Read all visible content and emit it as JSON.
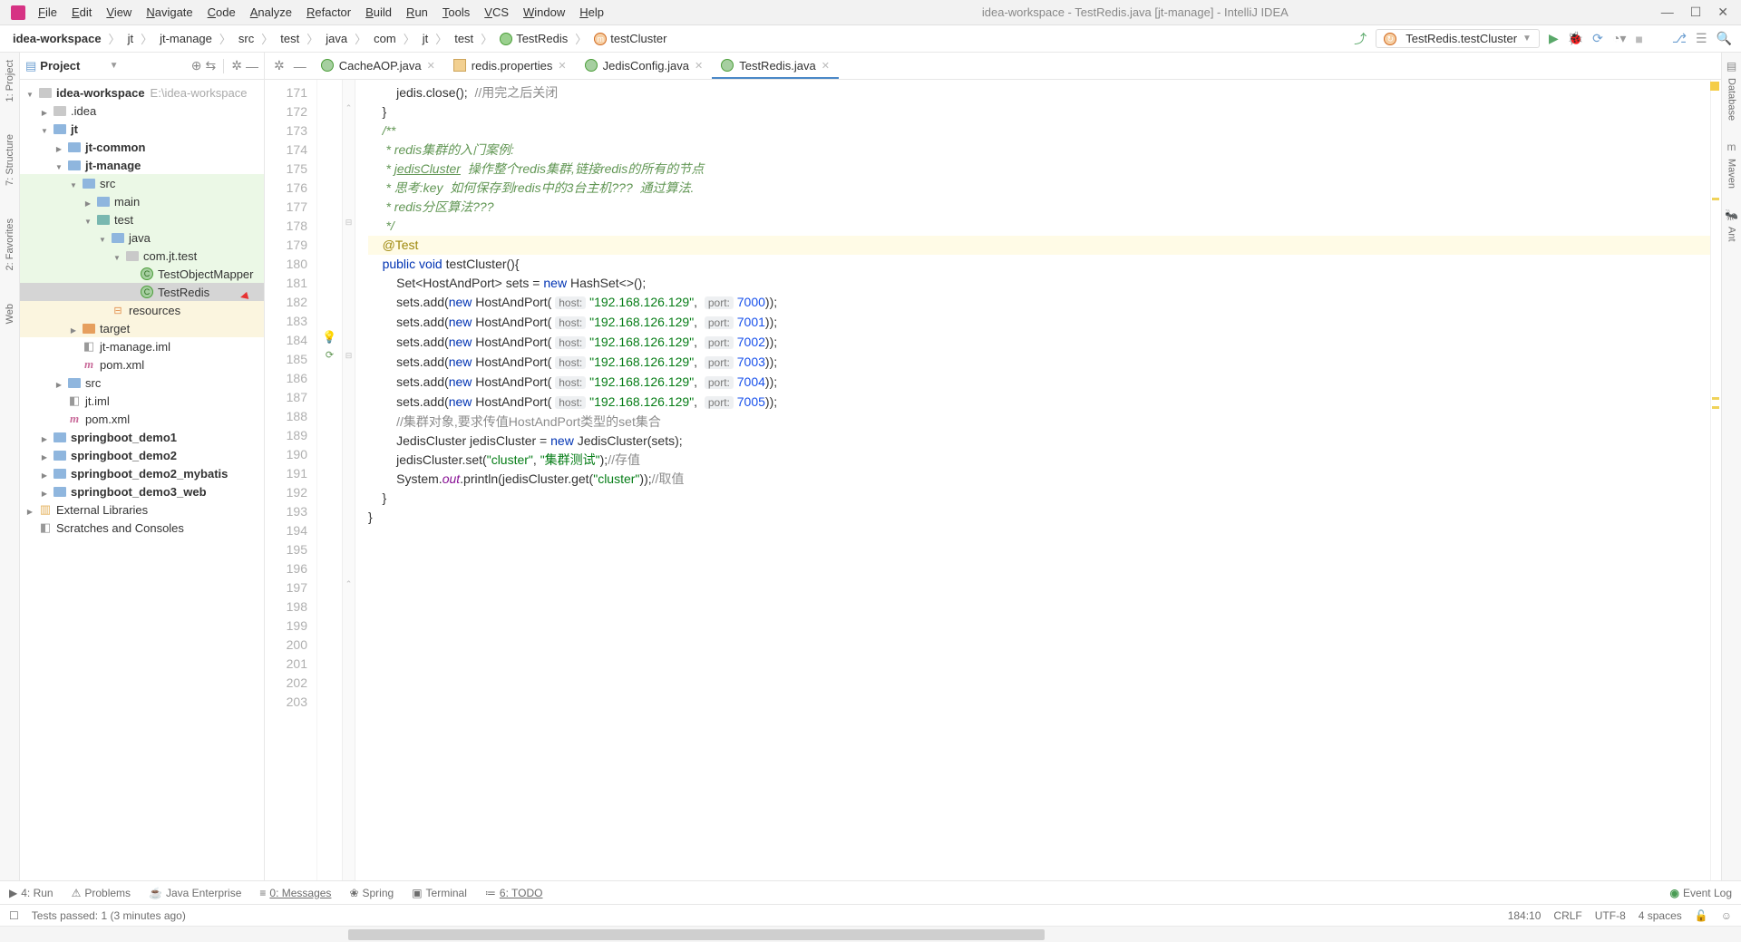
{
  "menus": [
    "File",
    "Edit",
    "View",
    "Navigate",
    "Code",
    "Analyze",
    "Refactor",
    "Build",
    "Run",
    "Tools",
    "VCS",
    "Window",
    "Help"
  ],
  "title": "idea-workspace - TestRedis.java [jt-manage] - IntelliJ IDEA",
  "breadcrumbs": [
    "idea-workspace",
    "jt",
    "jt-manage",
    "src",
    "test",
    "java",
    "com",
    "jt",
    "test",
    "TestRedis",
    "testCluster"
  ],
  "run_config": "TestRedis.testCluster",
  "left_rail": [
    "1: Project",
    "7: Structure",
    "2: Favorites",
    "Web"
  ],
  "right_rail": [
    "Database",
    "Maven",
    "Ant"
  ],
  "project": {
    "header": "Project",
    "root": {
      "name": "idea-workspace",
      "path": "E:\\idea-workspace"
    }
  },
  "tree": [
    {
      "indent": 0,
      "exp": "open",
      "icon": "folder",
      "label": "idea-workspace",
      "extra": "E:\\idea-workspace",
      "bold": true
    },
    {
      "indent": 1,
      "exp": "closed",
      "icon": "folder",
      "label": ".idea"
    },
    {
      "indent": 1,
      "exp": "open",
      "icon": "folder-blue",
      "label": "jt",
      "bold": true
    },
    {
      "indent": 2,
      "exp": "closed",
      "icon": "folder-blue",
      "label": "jt-common",
      "bold": true
    },
    {
      "indent": 2,
      "exp": "open",
      "icon": "folder-blue",
      "label": "jt-manage",
      "bold": true
    },
    {
      "indent": 3,
      "exp": "open",
      "icon": "folder-blue",
      "label": "src",
      "hl": "green"
    },
    {
      "indent": 4,
      "exp": "closed",
      "icon": "folder-blue",
      "label": "main",
      "hl": "green"
    },
    {
      "indent": 4,
      "exp": "open",
      "icon": "folder-teal",
      "label": "test",
      "hl": "green"
    },
    {
      "indent": 5,
      "exp": "open",
      "icon": "folder-blue",
      "label": "java",
      "hl": "green"
    },
    {
      "indent": 6,
      "exp": "open",
      "icon": "folder",
      "label": "com.jt.test",
      "hl": "green"
    },
    {
      "indent": 7,
      "exp": "none",
      "icon": "class",
      "label": "TestObjectMapper",
      "hl": "green"
    },
    {
      "indent": 7,
      "exp": "none",
      "icon": "class",
      "label": "TestRedis",
      "selected": true,
      "arrow": true
    },
    {
      "indent": 5,
      "exp": "none",
      "icon": "res",
      "label": "resources",
      "hl": "yellow"
    },
    {
      "indent": 3,
      "exp": "closed",
      "icon": "folder-orange",
      "label": "target",
      "hl": "yellow"
    },
    {
      "indent": 3,
      "exp": "none",
      "icon": "file",
      "label": "jt-manage.iml"
    },
    {
      "indent": 3,
      "exp": "none",
      "icon": "m",
      "label": "pom.xml"
    },
    {
      "indent": 2,
      "exp": "closed",
      "icon": "folder-blue",
      "label": "src"
    },
    {
      "indent": 2,
      "exp": "none",
      "icon": "file",
      "label": "jt.iml"
    },
    {
      "indent": 2,
      "exp": "none",
      "icon": "m",
      "label": "pom.xml"
    },
    {
      "indent": 1,
      "exp": "closed",
      "icon": "folder-blue",
      "label": "springboot_demo1",
      "bold": true
    },
    {
      "indent": 1,
      "exp": "closed",
      "icon": "folder-blue",
      "label": "springboot_demo2",
      "bold": true
    },
    {
      "indent": 1,
      "exp": "closed",
      "icon": "folder-blue",
      "label": "springboot_demo2_mybatis",
      "bold": true
    },
    {
      "indent": 1,
      "exp": "closed",
      "icon": "folder-blue",
      "label": "springboot_demo3_web",
      "bold": true
    },
    {
      "indent": 0,
      "exp": "closed",
      "icon": "lib",
      "label": "External Libraries"
    },
    {
      "indent": 0,
      "exp": "none",
      "icon": "file",
      "label": "Scratches and Consoles"
    }
  ],
  "tabs": [
    {
      "name": "CacheAOP.java",
      "icon": "class"
    },
    {
      "name": "redis.properties",
      "icon": "prop"
    },
    {
      "name": "JedisConfig.java",
      "icon": "class"
    },
    {
      "name": "TestRedis.java",
      "icon": "class",
      "active": true
    }
  ],
  "line_start": 171,
  "line_end": 203,
  "bottom": [
    "4: Run",
    "Problems",
    "Java Enterprise",
    "0: Messages",
    "Spring",
    "Terminal",
    "6: TODO"
  ],
  "event_log": "Event Log",
  "status_msg": "Tests passed: 1 (3 minutes ago)",
  "status_right": [
    "184:10",
    "CRLF",
    "UTF-8",
    "4 spaces"
  ],
  "code_hints": {
    "host": "host:",
    "port": "port:"
  },
  "code_text": {
    "close_comment": "//用完之后关闭",
    "doc1": "/**",
    "doc2": " * redis集群的入门案例:",
    "doc3a": " * ",
    "doc3b": "jedisCluster",
    "doc3c": "  操作整个redis集群,链接redis的所有的节点",
    "doc4a": " * 思考:key  如何保存到redis中的3台主机???  通过算法.",
    "doc5": " * redis分区算法???",
    "doc6": " */",
    "ann": "@Test",
    "sig": "testCluster",
    "ip": "\"192.168.126.129\"",
    "ports": [
      "7000",
      "7001",
      "7002",
      "7003",
      "7004",
      "7005"
    ],
    "cluster_comment": "//集群对象,要求传值HostAndPort类型的set集合",
    "store_comment": "//存值",
    "get_comment": "//取值",
    "str_cluster": "\"cluster\"",
    "str_test": "\"集群测试\""
  }
}
